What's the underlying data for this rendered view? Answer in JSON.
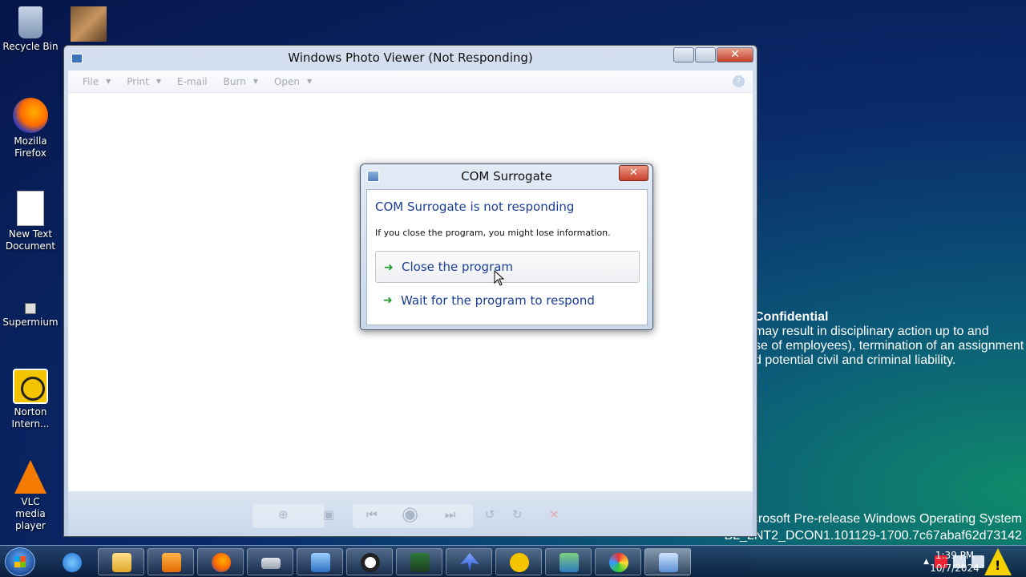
{
  "desktop": {
    "icons": [
      {
        "label": "Recycle Bin"
      },
      {
        "label": "Mozilla Firefox"
      },
      {
        "label": "New Text Document"
      },
      {
        "label": "Supermium"
      },
      {
        "label": "Norton Intern..."
      },
      {
        "label": "VLC media player"
      }
    ]
  },
  "photo_viewer": {
    "title": "Windows Photo Viewer (Not Responding)",
    "toolbar": {
      "file": "File",
      "print": "Print",
      "email": "E-mail",
      "burn": "Burn",
      "open": "Open"
    },
    "help_glyph": "?"
  },
  "dialog": {
    "title": "COM Surrogate",
    "close_glyph": "✕",
    "heading": "COM Surrogate is not responding",
    "message": "If you close the program, you might lose information.",
    "option_close": "Close the program",
    "option_wait": "Wait for the program to respond",
    "arrow_glyph": "➜"
  },
  "watermark": {
    "confidential_title": "Confidential",
    "line1": "may result in disciplinary action up to and",
    "line2": "se of employees), termination of an assignment",
    "line3": "d potential civil and criminal liability.",
    "prerelease_line1": "icrosoft Pre-release Windows Operating System",
    "prerelease_line2": "BL_LNT2_DCON1.101129-1700.7c67abaf62d73142"
  },
  "taskbar": {
    "time": "1:39 PM",
    "date": "10/7/2024"
  }
}
